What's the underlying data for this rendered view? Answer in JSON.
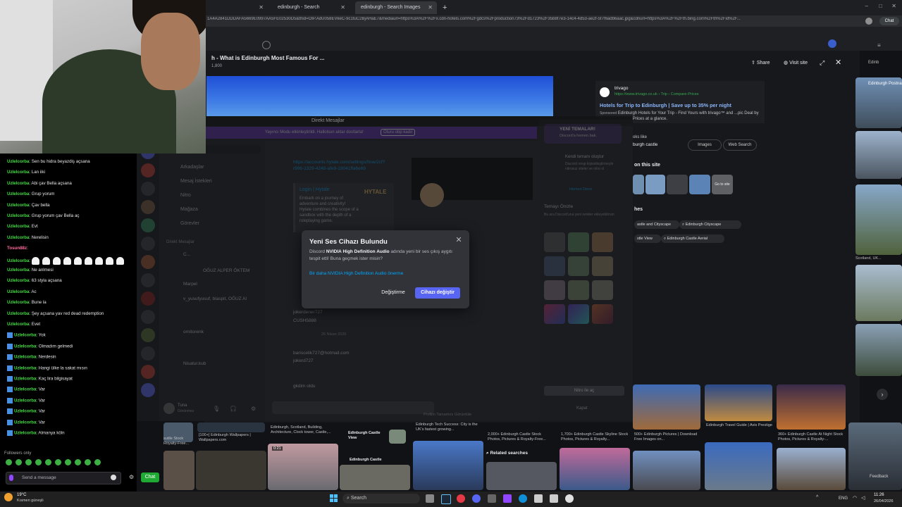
{
  "browser": {
    "tabs": [
      {
        "label": "edinburgh - Search"
      },
      {
        "label": "edinburgh - Search Images"
      }
    ],
    "new_tab": "+",
    "url": "1A4A2841DDDAFA5669E0997AA5FE02530D5&thid=OIP.AdU058EVkeC-9c1tuC2BjAHaE7&mediaurl=https%3A%2F%2Fx.cdn-hotels.com%2Fgdcs%2Fproduction73%2Fd1723%2F35b8f7e3-14c4-4d53-ae2f-5f7f6adb6aac.jpg&cdnurl=https%3A%2F%2Fth.bing.com%2Fth%2Fid%2F...",
    "chat_button": "Chat"
  },
  "viewer": {
    "title": "h - What is Edinburgh Most Famous For ...",
    "subtitle": "1,800",
    "share": "Share",
    "visit_site": "Visit site",
    "source": {
      "name": "trivago",
      "url": "https://www.trivago.co.uk › Trip › Compare-Prices",
      "headline": "Hotels for Trip to Edinburgh | Save up to 35% per night",
      "sponsored": "Sponsored",
      "description": "Edinburgh Hotels for Your Trip - Find Yours with trivago™ and ...pic Deal by Comparing Hotel Prices at a glance."
    },
    "looks_like": "oks like",
    "looks_like_value": "burgh castle",
    "images_btn": "Images",
    "web_search_btn": "Web Search",
    "on_this_site": "on this site",
    "go_to_site": "Go to site",
    "related_header": "hes",
    "chips": [
      "astle and Cityscape",
      "Edinburgh Cityscape",
      "stle View",
      "Edinburgh Castle Aerial"
    ],
    "right_edge_labels": [
      "Edinb",
      "Edinburgh Postna",
      "Scotland, UK..."
    ]
  },
  "discord": {
    "window_title": "Direkt Mesajlar",
    "banner_text": "Yayıncı Modu etkinleştirildi. Hallolsun aktar dostlarla!",
    "banner_button": "Oturu obp kadıl",
    "search_placeholder": "hbl ya da başlat",
    "left_items": [
      "Arkadaşlar",
      "Mesaj İstekleri",
      "Nitro",
      "Mağaza",
      "Görevler"
    ],
    "dm_header": "Direkt Mesajlar",
    "dm_names": [
      "C...",
      "OĞUZ ALPER ÖKTEM",
      "Marpel",
      "v_yusufyusuf, blaspit, OĞUZ Al",
      "ornitorenk",
      "Nisatur.kub",
      "Tuna"
    ],
    "messages": [
      "https://accounts.hytale.com/settings/flow/2cf?r996-1329-4248-afe9-18041ffa6e69",
      "Login | Hytale",
      "Embark on a journey of adventure and creativity! Hytale combines the scope of a sandbox with the depth of a roleplaying game.",
      "jokerdener727",
      "CUSH5888",
      "26 Nisan 2026",
      "bariscelik727@hotmail.com",
      "jokerd727",
      "gkdim oldu"
    ],
    "right_panel": {
      "new_themes": "YENİ TEMALAR!",
      "new_themes_sub": "Discord'a hemen bak.",
      "own_theme_title": "Kendi temanı oluştur",
      "own_theme_text": "Discord rengi kişiselleştirmeyle nitrosuz siteler ve nitro ol",
      "try_now": "Hemen Dene",
      "preview_title": "Temayı Önizle",
      "preview_text": "Bu ara Discord'una yeni renkler ekleyebilirsin",
      "nitro_button": "Nitro ile aç",
      "close": "Kapat"
    },
    "footer": "Profilin Tamamını Görüntüle",
    "user_name": "Tuna",
    "user_status": "Görünmez"
  },
  "modal": {
    "title": "Yeni Ses Cihazı Bulundu",
    "body_prefix": "Discord ",
    "device": "NVIDIA High Definition Audio",
    "body_suffix": " adında yeni bir ses çıkış aygıtı tespit etti! Buna geçmek ister misin?",
    "link": "Bir daha NVIDIA High Definition Audio önerme",
    "cancel": "Değiştirme",
    "confirm": "Cihazı değiştir"
  },
  "twitch_chat": {
    "lines": [
      {
        "user": "Uzlelcorba",
        "text": "Sen bu hidra beyazdiş açsana"
      },
      {
        "user": "Uzlelcorba",
        "text": "Lan iiki"
      },
      {
        "user": "Uzlelcorba",
        "text": "Abi çav Bella açsana"
      },
      {
        "user": "Uzlelcorba",
        "text": "Grup yorum"
      },
      {
        "user": "Uzlelcorba",
        "text": "Çav bella"
      },
      {
        "user": "Uzlelcorba",
        "text": "Grup yorum çav Bella aç"
      },
      {
        "user": "Uzlelcorba",
        "text": "Evt"
      },
      {
        "user": "Uzlelcorba",
        "text": "Nerelisin"
      },
      {
        "user": "Tosun88z",
        "text": ""
      },
      {
        "user": "Uzlelcorba",
        "text": ""
      },
      {
        "user": "Uzlelcorba",
        "text": "Ne anlmesi"
      },
      {
        "user": "Uzlelcorba",
        "text": "63 styla açsana"
      },
      {
        "user": "Uzlelcorba",
        "text": "Ac"
      },
      {
        "user": "Uzlelcorba",
        "text": "Bune la"
      },
      {
        "user": "Uzlelcorba",
        "text": "Şey açsana yav red dead redemption"
      },
      {
        "user": "Uzlelcorba",
        "text": "Evet"
      },
      {
        "user": "Uzlelcorba",
        "text": "Yok"
      },
      {
        "user": "Uzlelcorba",
        "text": "Olmadım gelmedi"
      },
      {
        "user": "Uzlelcorba",
        "text": "Nerdesin"
      },
      {
        "user": "Uzlelcorba",
        "text": "Hangi ülke la sakat mısın"
      },
      {
        "user": "Uzlelcorba",
        "text": "Kaç lira bilgisayat"
      },
      {
        "user": "Uzlelcorba",
        "text": "Var"
      },
      {
        "user": "Uzlelcorba",
        "text": "Var"
      },
      {
        "user": "Uzlelcorba",
        "text": "Var"
      },
      {
        "user": "Uzlelcorba",
        "text": "Var"
      },
      {
        "user": "Uzlelcorba",
        "text": "Almanya köln"
      }
    ],
    "followers_only": "Followers only",
    "input_placeholder": "Send a message",
    "chat_button": "Chat"
  },
  "image_grid": {
    "captions": [
      "sutile Stock Royalty-Free...",
      "[100+] Edinburgh Wallpapers | Wallpapers.com",
      "Edinburgh, Scotland, Building, Architecture, Clock tower, Castle,...",
      "Edinburgh Castle View",
      "Edinburgh Tech Success: City is the UK's fastest growing...",
      "2,000+ Edinburgh Castle Stock Photos, Pictures & Royalty-Free...",
      "1,700+ Edinburgh Castle Skyline Stock Photos, Pictures & Royalty...",
      "500+ Edinburgh Pictures | Download Free Images on...",
      "Edinburgh Travel Guide | Avis Prestige",
      "360+ Edinburgh Castle At Night Stock Photos, Pictures & Royalty-...",
      "Edinburgh Castle"
    ],
    "video_time": "0:21",
    "related_searches": "Related searches",
    "feedback": "Feedback"
  },
  "taskbar": {
    "weather_temp": "19°C",
    "weather_text": "Kısmen güneşli",
    "search_label": "Search",
    "lang": "ENG",
    "time": "11:26",
    "date": "26/04/2026"
  }
}
